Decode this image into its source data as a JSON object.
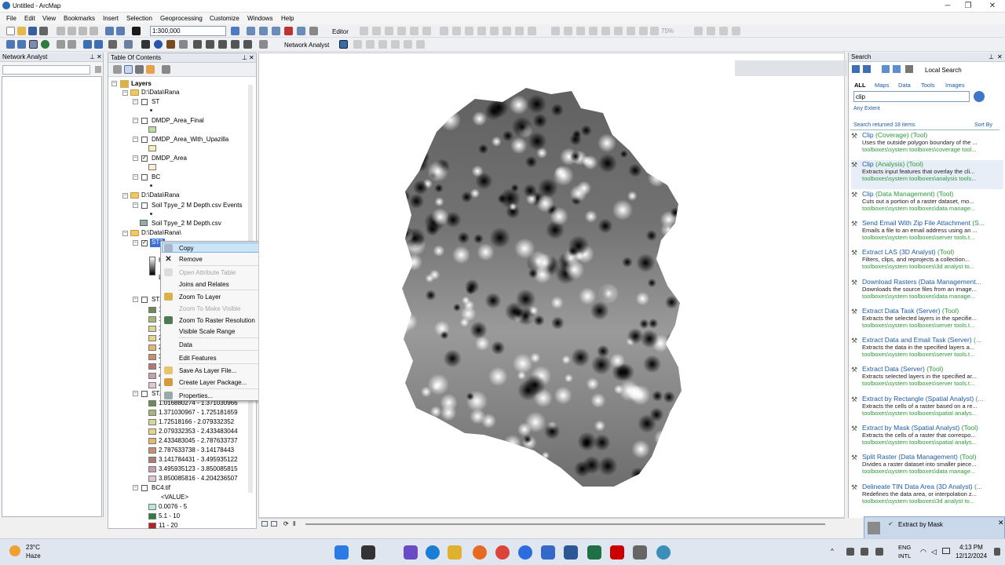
{
  "window": {
    "title": "Untitled - ArcMap"
  },
  "menu": [
    "File",
    "Edit",
    "View",
    "Bookmarks",
    "Insert",
    "Selection",
    "Geoprocessing",
    "Customize",
    "Windows",
    "Help"
  ],
  "toolbar": {
    "scale": "1:300,000",
    "editor": "Editor",
    "network_analyst": "Network Analyst",
    "zoom_percent": "75%"
  },
  "network_panel": {
    "title": "Network Analyst"
  },
  "toc": {
    "title": "Table Of Contents",
    "layers_label": "Layers",
    "group1": "D:\\Data\\Rana",
    "st": "ST",
    "dmdp_final": "DMDP_Area_Final",
    "dmdp_upazilla": "DMDP_Area_With_Upazilla",
    "dmdp_area": "DMDP_Area",
    "bc": "BC",
    "group2": "D:\\Data\\Rana",
    "soil_events": "Soil Tpye_2 M Depth.csv Events",
    "soil_csv": "Soil Tpye_2 M Depth.csv",
    "group3": "D:\\Data\\Rana\\",
    "st3_selected": "ST3",
    "st3_h": "H",
    "st3_l": "L",
    "st2": "ST2",
    "st2_items": [
      "1",
      "1",
      "1",
      "2",
      "2",
      "3",
      "3",
      "4",
      "4"
    ],
    "sttif": "ST.t",
    "sttif_ranges": [
      "1.016880274 - 1.371030966",
      "1.371030967 - 1.725181659",
      "1.72518166 - 2.079332352",
      "2.079332353 - 2.433483044",
      "2.433483045 - 2.787633737",
      "2.787633738 - 3.14178443",
      "3.141784431 - 3.495935122",
      "3.495935123 - 3.850085815",
      "3.850085816 - 4.204236507"
    ],
    "bc4": "BC4.tif",
    "bc4_value": "<VALUE>",
    "bc4_ranges": [
      "0.0076 - 5",
      "5.1 - 10",
      "11 - 20"
    ]
  },
  "context_menu": {
    "copy": "Copy",
    "remove": "Remove",
    "open_attr": "Open Attribute Table",
    "joins": "Joins and Relates",
    "zoom_layer": "Zoom To Layer",
    "zoom_visible": "Zoom To Make Visible",
    "zoom_raster": "Zoom To Raster Resolution",
    "visible_scale": "Visible Scale Range",
    "data": "Data",
    "edit_features": "Edit Features",
    "save_layer": "Save As Layer File...",
    "create_package": "Create Layer Package...",
    "properties": "Properties..."
  },
  "search": {
    "title": "Search",
    "mode": "Local Search",
    "tabs": [
      "ALL",
      "Maps",
      "Data",
      "Tools",
      "Images"
    ],
    "query": "clip",
    "extent": "Any Extent",
    "returned": "Search returned 18 items",
    "sort": "Sort By",
    "results": [
      {
        "name": "Clip",
        "type": "(Coverage) (Tool)",
        "desc": "Uses the outside polygon boundary of the ...",
        "path": "toolboxes\\system toolboxes\\coverage tool..."
      },
      {
        "name": "Clip",
        "type": "(Analysis) (Tool)",
        "desc": "Extracts input features that overlay the cli...",
        "path": "toolboxes\\system toolboxes\\analysis tools..."
      },
      {
        "name": "Clip",
        "type": "(Data Management) (Tool)",
        "desc": "Cuts out a portion of a raster dataset, mo...",
        "path": "toolboxes\\system toolboxes\\data manage..."
      },
      {
        "name": "Send Email With Zip File Attachment",
        "type": "(S...",
        "desc": "Emails a file to an email address using an ...",
        "path": "toolboxes\\system toolboxes\\server tools.t..."
      },
      {
        "name": "Extract LAS (3D Analyst)",
        "type": "(Tool)",
        "desc": "Filters, clips, and reprojects a collection...",
        "path": "toolboxes\\system toolboxes\\3d analyst to..."
      },
      {
        "name": "Download Rasters (Data Management...",
        "type": "",
        "desc": "Downloads the source files from an image...",
        "path": "toolboxes\\system toolboxes\\data manage..."
      },
      {
        "name": "Extract Data Task (Server)",
        "type": "(Tool)",
        "desc": "Extracts the selected layers in the specifie...",
        "path": "toolboxes\\system toolboxes\\server tools.t..."
      },
      {
        "name": "Extract Data and Email Task (Server)",
        "type": "(...",
        "desc": "Extracts the data in the specified layers a...",
        "path": "toolboxes\\system toolboxes\\server tools.t..."
      },
      {
        "name": "Extract Data (Server)",
        "type": "(Tool)",
        "desc": "Extracts selected layers in the specified ar...",
        "path": "toolboxes\\system toolboxes\\server tools.t..."
      },
      {
        "name": "Extract by Rectangle (Spatial Analyst)",
        "type": "(...",
        "desc": "Extracts the cells of a raster based on a re...",
        "path": "toolboxes\\system toolboxes\\spatial analys..."
      },
      {
        "name": "Extract by Mask (Spatial Analyst)",
        "type": "(Tool)",
        "desc": "Extracts the cells of a raster that correspo...",
        "path": "toolboxes\\system toolboxes\\spatial analys..."
      },
      {
        "name": "Split Raster (Data Management)",
        "type": "(Tool)",
        "desc": "Divides a raster dataset into smaller piece...",
        "path": "toolboxes\\system toolboxes\\data manage..."
      },
      {
        "name": "Delineate TIN Data Area (3D Analyst)",
        "type": "(...",
        "desc": "Redefines the data area, or interpolation z...",
        "path": "toolboxes\\system toolboxes\\3d analyst to..."
      }
    ]
  },
  "toast": {
    "title": "Extract by Mask"
  },
  "taskbar": {
    "temp": "23°C",
    "weather": "Haze",
    "lang1": "ENG",
    "lang2": "INTL",
    "time": "4:13 PM",
    "date": "12/12/2024"
  }
}
